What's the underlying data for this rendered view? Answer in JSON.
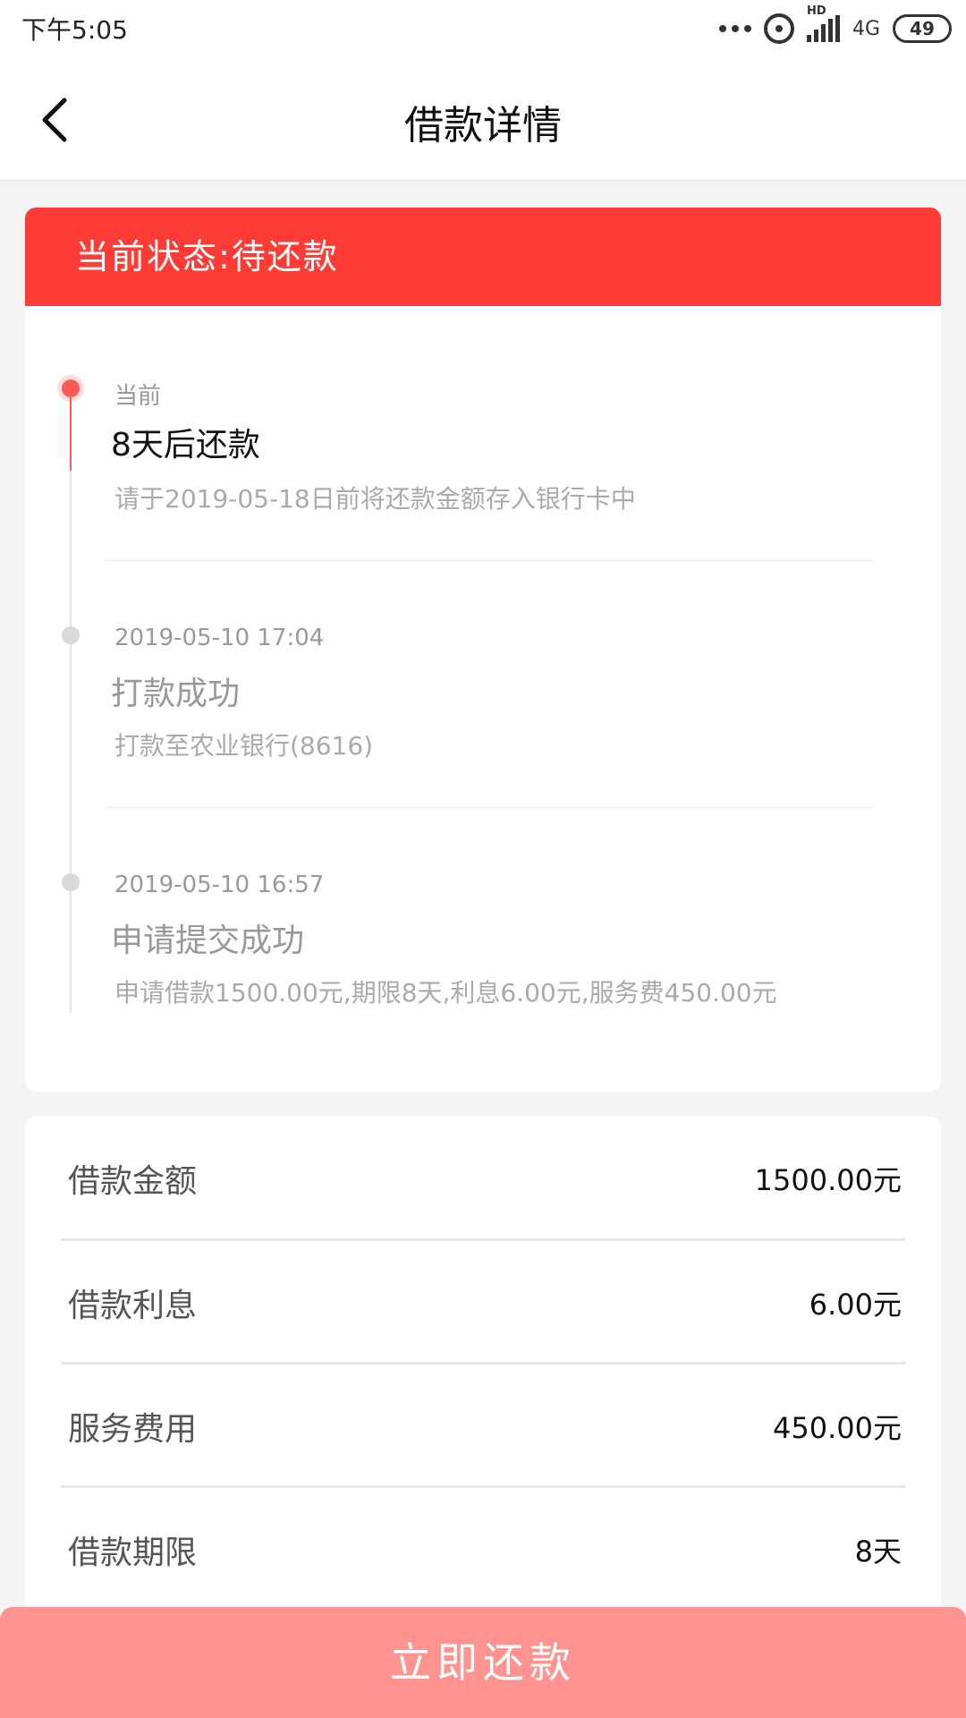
{
  "statusbar": {
    "time": "下午5:05",
    "network": "4G",
    "hd": "HD",
    "battery": "49"
  },
  "navbar": {
    "title": "借款详情"
  },
  "status": {
    "label": "当前状态:待还款"
  },
  "timeline": [
    {
      "top": "当前",
      "title": "8天后还款",
      "desc": "请于2019-05-18日前将还款金额存入银行卡中"
    },
    {
      "top": "2019-05-10 17:04",
      "title": "打款成功",
      "desc": "打款至农业银行(8616)"
    },
    {
      "top": "2019-05-10 16:57",
      "title": "申请提交成功",
      "desc": "申请借款1500.00元,期限8天,利息6.00元,服务费450.00元"
    }
  ],
  "info": [
    {
      "label": "借款金额",
      "value": "1500.00元"
    },
    {
      "label": "借款利息",
      "value": "6.00元"
    },
    {
      "label": "服务费用",
      "value": "450.00元"
    },
    {
      "label": "借款期限",
      "value": "8天"
    }
  ],
  "action": {
    "repay_label": "立即还款"
  },
  "colors": {
    "accent": "#ff3b36",
    "button": "#ff9390",
    "active_dot": "#ff5a55"
  }
}
